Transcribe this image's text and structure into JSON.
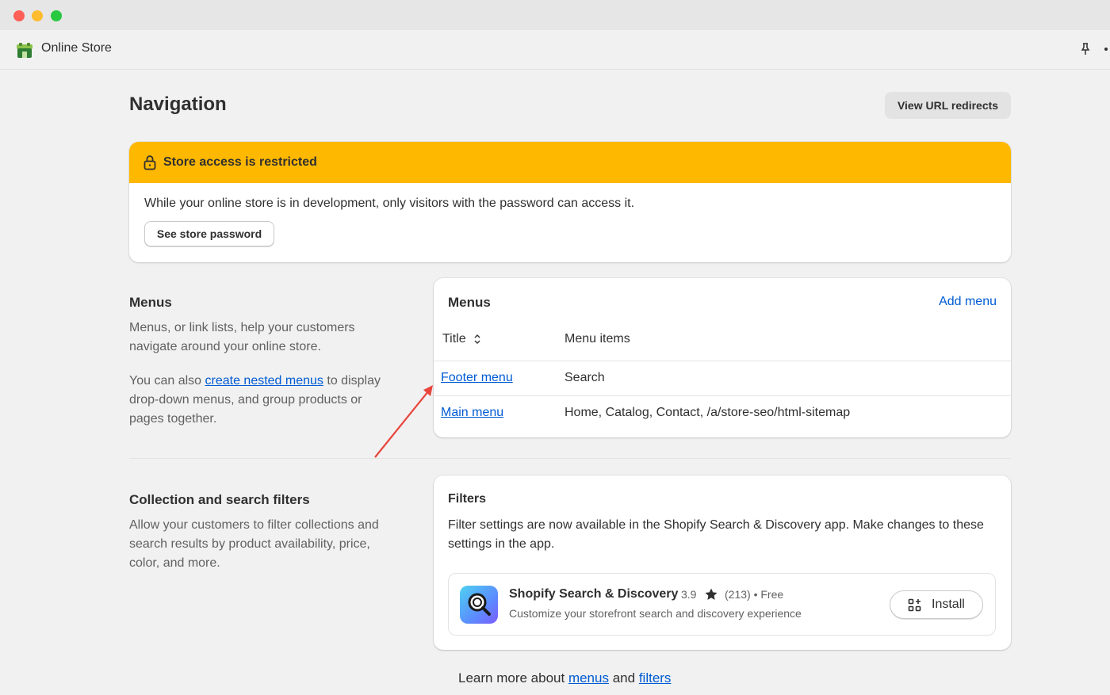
{
  "app": {
    "title": "Online Store"
  },
  "page": {
    "title": "Navigation",
    "redirects_button": "View URL redirects"
  },
  "banner": {
    "title": "Store access is restricted",
    "text": "While your online store is in development, only visitors with the password can access it.",
    "button": "See store password",
    "color": "#ffb800"
  },
  "menus_section": {
    "title": "Menus",
    "desc1": "Menus, or link lists, help your customers navigate around your online store.",
    "desc2_prefix": "You can also",
    "desc2_link": "create nested menus",
    "desc2_suffix": "to display drop-down menus, and group products or pages together."
  },
  "menus_card": {
    "title": "Menus",
    "add_menu": "Add menu",
    "col_title": "Title",
    "col_items": "Menu items",
    "rows": [
      {
        "title": "Footer menu",
        "items": "Search"
      },
      {
        "title": "Main menu",
        "items": "Home, Catalog, Contact, /a/store-seo/html-sitemap"
      }
    ]
  },
  "filters_section": {
    "title": "Collection and search filters",
    "desc": "Allow your customers to filter collections and search results by product availability, price, color, and more."
  },
  "filters_card": {
    "title": "Filters",
    "text": "Filter settings are now available in the Shopify Search & Discovery app. Make changes to these settings in the app.",
    "app_name": "Shopify Search & Discovery",
    "rating": "3.9",
    "reviews": "(213)",
    "price": "Free",
    "app_desc": "Customize your storefront search and discovery experience",
    "install": "Install"
  },
  "footer": {
    "prefix": "Learn more about",
    "link1": "menus",
    "middle": "and",
    "link2": "filters"
  },
  "colors": {
    "link": "#005bd3",
    "annotation_arrow": "#e8453c"
  }
}
